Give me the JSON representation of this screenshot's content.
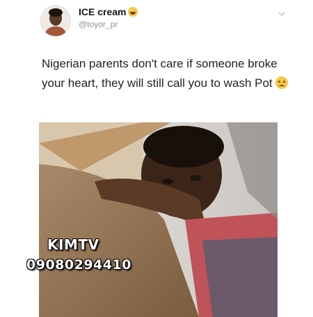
{
  "tweet": {
    "display_name": "ICE cream",
    "name_emoji": "face-with-tears-of-joy",
    "handle": "@toyor_pr",
    "text": "Nigerian parents don't care if someone broke your heart, they will still call you to wash Pot",
    "text_emoji": "sad-face"
  },
  "watermark": {
    "name": "KIMTV",
    "phone": "09080294410"
  },
  "colors": {
    "name": "#14171a",
    "handle": "#8a949d",
    "text": "#1c2025"
  }
}
